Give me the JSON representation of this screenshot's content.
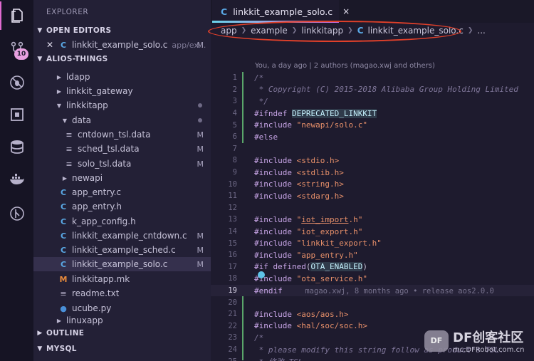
{
  "activity_bar": {
    "items": [
      {
        "name": "explorer-icon"
      },
      {
        "name": "source-control-icon",
        "badge": "10"
      },
      {
        "name": "debug-icon"
      },
      {
        "name": "extensions-icon"
      },
      {
        "name": "database-icon"
      },
      {
        "name": "docker-icon"
      },
      {
        "name": "git-graph-icon"
      }
    ]
  },
  "sidebar": {
    "title": "EXPLORER",
    "open_editors": {
      "label": "OPEN EDITORS",
      "items": [
        {
          "name": "linkkit_example_solo.c",
          "path": "app/ex...",
          "status": "M"
        }
      ]
    },
    "workspace": {
      "label": "ALIOS-THINGS",
      "items": [
        {
          "label": "ldapp",
          "kind": "folder",
          "expanded": false,
          "status": ""
        },
        {
          "label": "linkkit_gateway",
          "kind": "folder",
          "expanded": false,
          "status": ""
        },
        {
          "label": "linkkitapp",
          "kind": "folder",
          "expanded": true,
          "status": "dot"
        },
        {
          "label": "data",
          "kind": "folder",
          "expanded": true,
          "status": "dot"
        },
        {
          "label": "cntdown_tsl.data",
          "kind": "file",
          "status": "M"
        },
        {
          "label": "sched_tsl.data",
          "kind": "file",
          "status": "M"
        },
        {
          "label": "solo_tsl.data",
          "kind": "file",
          "status": "M"
        },
        {
          "label": "newapi",
          "kind": "folder",
          "expanded": false,
          "status": ""
        },
        {
          "label": "app_entry.c",
          "kind": "c",
          "status": ""
        },
        {
          "label": "app_entry.h",
          "kind": "c",
          "status": ""
        },
        {
          "label": "k_app_config.h",
          "kind": "c",
          "status": ""
        },
        {
          "label": "linkkit_example_cntdown.c",
          "kind": "c",
          "status": "M"
        },
        {
          "label": "linkkit_example_sched.c",
          "kind": "c",
          "status": "M"
        },
        {
          "label": "linkkit_example_solo.c",
          "kind": "c",
          "status": "M"
        },
        {
          "label": "linkkitapp.mk",
          "kind": "mk",
          "status": ""
        },
        {
          "label": "readme.txt",
          "kind": "file",
          "status": ""
        },
        {
          "label": "ucube.py",
          "kind": "py",
          "status": ""
        },
        {
          "label": "linuxapp",
          "kind": "folder",
          "expanded": false,
          "status": ""
        }
      ]
    },
    "outline_label": "OUTLINE",
    "mysql_label": "MYSQL"
  },
  "editor": {
    "tab": {
      "label": "linkkit_example_solo.c",
      "close": "×"
    },
    "breadcrumb": [
      "app",
      "example",
      "linkkitapp",
      "linkkit_example_solo.c",
      "..."
    ],
    "blame_header": "You, a day ago | 2 authors (magao.xwj and others)",
    "current_line": 19,
    "inline_blame": "magao.xwj, 8 months ago • release aos2.0.0",
    "lines": [
      {
        "n": "1",
        "t": "/*"
      },
      {
        "n": "2",
        "t": " * Copyright (C) 2015-2018 Alibaba Group Holding Limited"
      },
      {
        "n": "3",
        "t": " */"
      },
      {
        "n": "4",
        "t": "#ifndef DEPRECATED_LINKKIT"
      },
      {
        "n": "5",
        "t": "#include \"newapi/solo.c\""
      },
      {
        "n": "6",
        "t": "#else"
      },
      {
        "n": "7",
        "t": ""
      },
      {
        "n": "8",
        "t": "#include <stdio.h>"
      },
      {
        "n": "9",
        "t": "#include <stdlib.h>"
      },
      {
        "n": "10",
        "t": "#include <string.h>"
      },
      {
        "n": "11",
        "t": "#include <stdarg.h>"
      },
      {
        "n": "12",
        "t": ""
      },
      {
        "n": "13",
        "t": "#include \"iot_import.h\""
      },
      {
        "n": "14",
        "t": "#include \"iot_export.h\""
      },
      {
        "n": "15",
        "t": "#include \"linkkit_export.h\""
      },
      {
        "n": "16",
        "t": "#include \"app_entry.h\""
      },
      {
        "n": "17",
        "t": "#if defined(OTA_ENABLED)"
      },
      {
        "n": "18",
        "t": "#include \"ota_service.h\""
      },
      {
        "n": "19",
        "t": "#endif"
      },
      {
        "n": "20",
        "t": ""
      },
      {
        "n": "21",
        "t": "#include <aos/aos.h>"
      },
      {
        "n": "22",
        "t": "#include <hal/soc/soc.h>"
      },
      {
        "n": "23",
        "t": "/*"
      },
      {
        "n": "24",
        "t": " * please modify this string follow as product's TSL."
      },
      {
        "n": "25",
        "t": " * 修改 TSL"
      }
    ]
  },
  "watermark": {
    "title": "DF创客社区",
    "url": "mc.DFRobot.com.cn"
  }
}
